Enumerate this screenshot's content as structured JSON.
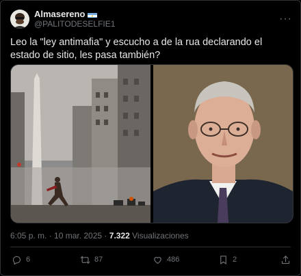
{
  "post": {
    "author": {
      "display_name": "Almasereno",
      "handle": "@PALITODESELFIE1",
      "flag_icon": "argentina-flag-icon"
    },
    "text": "Leo la \"ley antimafia\" y escucho a de la rua declarando el estado de sitio, les pasa también?",
    "media": [
      {
        "icon": "street-protest-photo"
      },
      {
        "icon": "portrait-photo"
      }
    ],
    "timestamp": "6:05 p. m. · 10 mar. 2025",
    "views_count": "7.322",
    "views_label": "Visualizaciones",
    "actions": {
      "replies": "6",
      "reposts": "87",
      "likes": "486",
      "bookmarks": "2"
    }
  },
  "colors": {
    "background": "#000000",
    "text": "#e7e9ea",
    "muted": "#71767b",
    "border": "#2f3336"
  }
}
